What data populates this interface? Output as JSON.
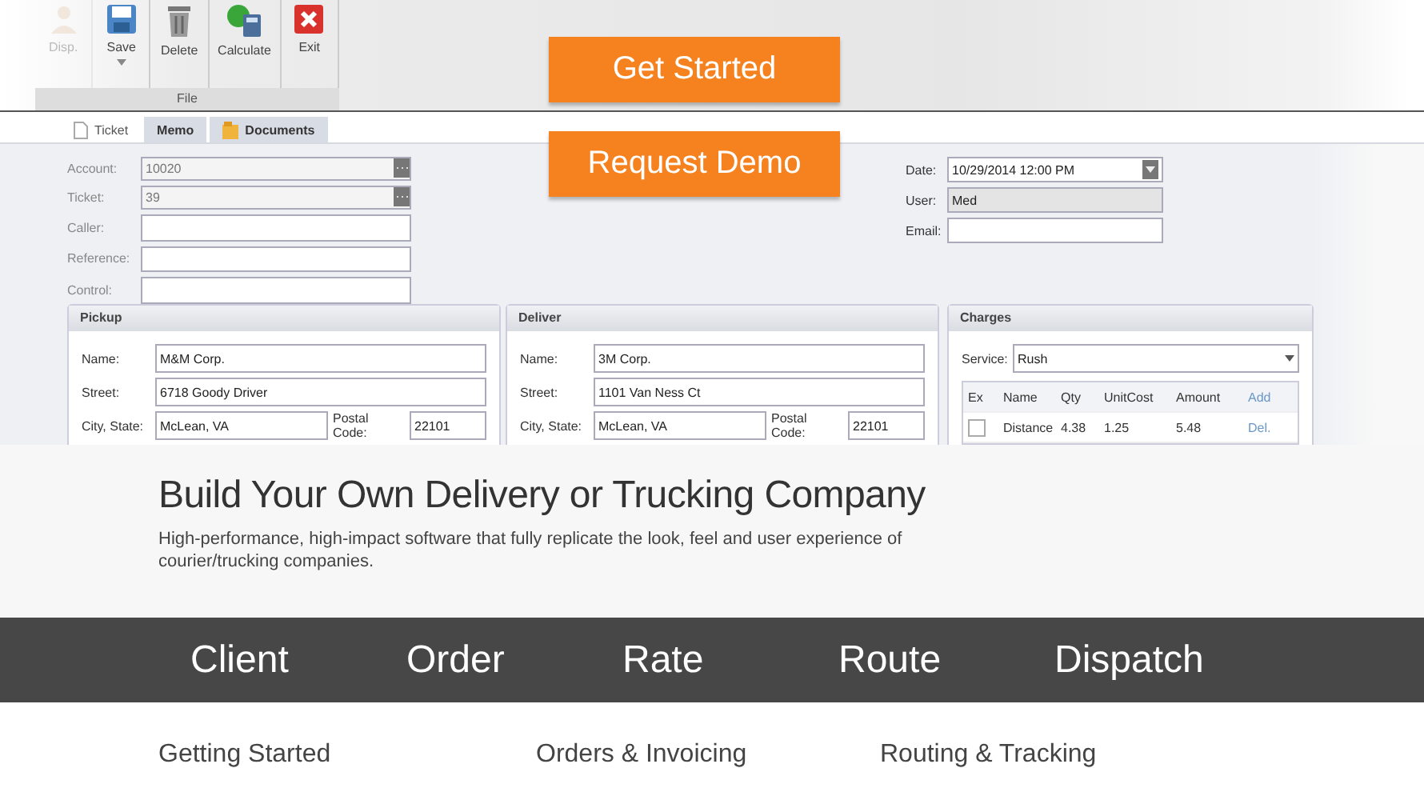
{
  "ribbon": {
    "buttons": [
      {
        "label": "Disp.",
        "disabled": true
      },
      {
        "label": "Save",
        "disabled": false
      },
      {
        "label": "Delete",
        "disabled": false
      },
      {
        "label": "Calculate",
        "disabled": false
      },
      {
        "label": "Exit",
        "disabled": false
      }
    ],
    "group_label": "File"
  },
  "cta": [
    "Get Started",
    "Request Demo"
  ],
  "tabs": [
    {
      "label": "Ticket",
      "selected": true
    },
    {
      "label": "Memo",
      "selected": false
    },
    {
      "label": "Documents",
      "selected": false
    }
  ],
  "ticket_fields": [
    {
      "label": "Account:",
      "value": "10020",
      "kind": "lookup"
    },
    {
      "label": "Ticket:",
      "value": "39",
      "kind": "lookup"
    },
    {
      "label": "Caller:",
      "kind": "text"
    },
    {
      "label": "Reference:",
      "kind": "text"
    },
    {
      "label": "Control:",
      "kind": "text"
    }
  ],
  "meta_fields": [
    {
      "label": "Date:",
      "value": "10/29/2014 12:00 PM",
      "kind": "date"
    },
    {
      "label": "User:",
      "value": "Med",
      "kind": "readonly"
    },
    {
      "label": "Email:",
      "kind": "text"
    }
  ],
  "panels": [
    {
      "title": "Pickup",
      "rows": [
        {
          "label": "Name:",
          "value": "M&M Corp.",
          "kind": "text"
        },
        {
          "label": "Street:",
          "value": "6718 Goody Driver",
          "kind": "text"
        },
        {
          "label": "City, State:",
          "value": "McLean, VA",
          "kind": "city",
          "postal_label": "Postal Code:",
          "postal": "22101"
        }
      ]
    },
    {
      "title": "Deliver",
      "rows": [
        {
          "label": "Name:",
          "value": "3M Corp.",
          "kind": "text"
        },
        {
          "label": "Street:",
          "value": "1101 Van Ness Ct",
          "kind": "text"
        },
        {
          "label": "City, State:",
          "value": "McLean, VA",
          "kind": "city",
          "postal_label": "Postal Code:",
          "postal": "22101"
        }
      ]
    }
  ],
  "charges": {
    "title": "Charges",
    "service_label": "Service:",
    "service": "Rush",
    "columns": [
      "Ex",
      "Name",
      "Qty",
      "UnitCost",
      "Amount",
      "Add"
    ],
    "rows": [
      {
        "checked": false,
        "name": "Distance",
        "qty": "4.38",
        "unit_cost": "1.25",
        "amount": "5.48",
        "action": "Del."
      }
    ]
  },
  "hero": {
    "heading": "Build Your Own Delivery or Trucking Company",
    "text": "High-performance, high-impact software that fully replicate the look, feel and user experience of courier/trucking companies."
  },
  "nav": [
    {
      "label": "Client"
    },
    {
      "label": "Order"
    },
    {
      "label": "Rate"
    },
    {
      "label": "Route"
    },
    {
      "label": "Dispatch"
    }
  ],
  "features": [
    "Getting Started",
    "Orders & Invoicing",
    "Routing & Tracking"
  ]
}
